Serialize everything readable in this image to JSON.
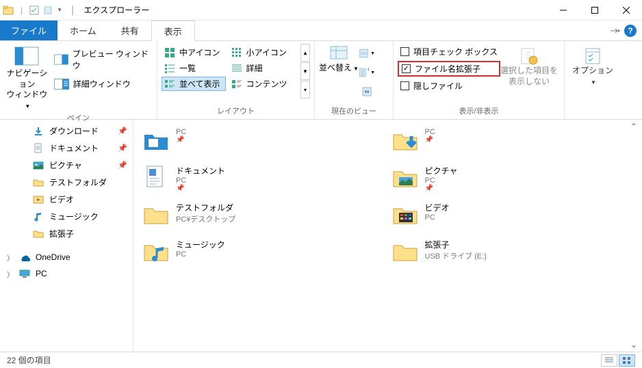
{
  "title": "エクスプローラー",
  "tabs": {
    "file": "ファイル",
    "home": "ホーム",
    "share": "共有",
    "view": "表示"
  },
  "ribbon": {
    "panes": {
      "nav": "ナビゲーション\nウィンドウ",
      "preview": "プレビュー ウィンドウ",
      "details": "詳細ウィンドウ",
      "group": "ペイン"
    },
    "layout": {
      "medium": "中アイコン",
      "small": "小アイコン",
      "list": "一覧",
      "details": "詳細",
      "tiles": "並べて表示",
      "content": "コンテンツ",
      "group": "レイアウト"
    },
    "currentview": {
      "sort": "並べ替え",
      "group": "現在のビュー"
    },
    "showhide": {
      "itemcheck": "項目チェック ボックス",
      "extensions": "ファイル名拡張子",
      "hidden": "隠しファイル",
      "hideselected": "選択した項目を\n表示しない",
      "group": "表示/非表示"
    },
    "options": "オプション"
  },
  "sidebar": [
    {
      "icon": "download",
      "label": "ダウンロード",
      "pinned": true
    },
    {
      "icon": "document",
      "label": "ドキュメント",
      "pinned": true
    },
    {
      "icon": "pictures",
      "label": "ピクチャ",
      "pinned": true
    },
    {
      "icon": "folder",
      "label": "テストフォルダ",
      "pinned": false
    },
    {
      "icon": "videos",
      "label": "ビデオ",
      "pinned": false
    },
    {
      "icon": "music",
      "label": "ミュージック",
      "pinned": false
    },
    {
      "icon": "folder",
      "label": "拡張子",
      "pinned": false
    },
    {
      "icon": "onedrive",
      "label": "OneDrive",
      "top": true
    },
    {
      "icon": "pc",
      "label": "PC",
      "top": true
    }
  ],
  "items": [
    {
      "icon": "folder-blue",
      "name": "",
      "sub": "PC",
      "pinned": true
    },
    {
      "icon": "download-big",
      "name": "",
      "sub": "PC",
      "pinned": true
    },
    {
      "icon": "document-big",
      "name": "ドキュメント",
      "sub": "PC",
      "pinned": true
    },
    {
      "icon": "pictures-big",
      "name": "ピクチャ",
      "sub": "PC",
      "pinned": true
    },
    {
      "icon": "folder",
      "name": "テストフォルダ",
      "sub": "PC¥デスクトップ"
    },
    {
      "icon": "videos-big",
      "name": "ビデオ",
      "sub": "PC"
    },
    {
      "icon": "music-big",
      "name": "ミュージック",
      "sub": "PC"
    },
    {
      "icon": "folder",
      "name": "拡張子",
      "sub": "USB ドライブ (E:)"
    }
  ],
  "status": {
    "count": "22 個の項目"
  }
}
